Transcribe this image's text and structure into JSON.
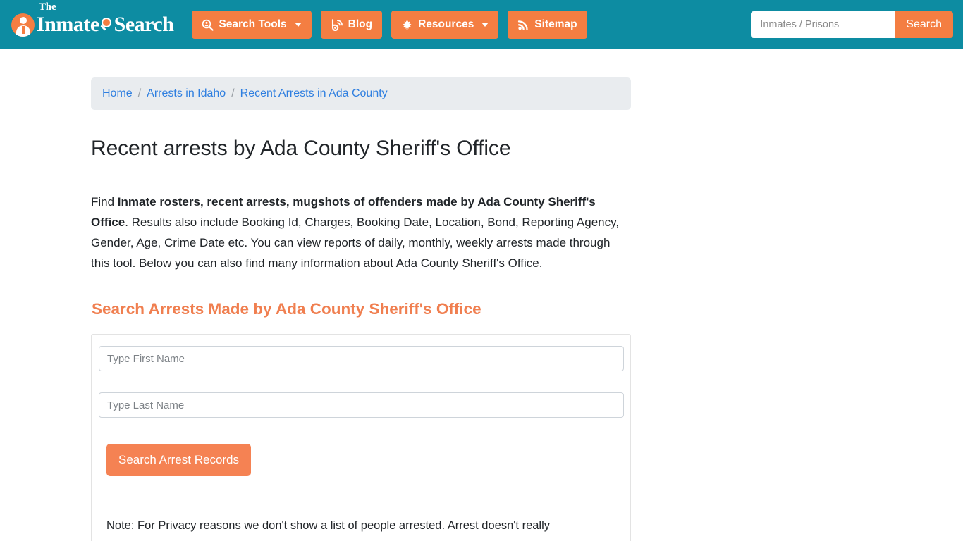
{
  "header": {
    "brand": {
      "the": "The",
      "word_one": "Inmate",
      "word_two": "Search",
      "badge_icon": "person-in-circle-icon",
      "glass_icon": "magnifier-icon"
    },
    "nav": [
      {
        "label": "Search Tools",
        "icon": "magnifier-person-icon",
        "has_caret": true
      },
      {
        "label": "Blog",
        "icon": "blog-b-icon",
        "has_caret": false
      },
      {
        "label": "Resources",
        "icon": "leaf-icon",
        "has_caret": true
      },
      {
        "label": "Sitemap",
        "icon": "rss-feed-icon",
        "has_caret": false
      }
    ],
    "search": {
      "placeholder": "Inmates / Prisons",
      "value": "",
      "button_label": "Search"
    }
  },
  "breadcrumb": [
    {
      "label": "Home",
      "link": true
    },
    {
      "label": "Arrests in Idaho",
      "link": true
    },
    {
      "label": "Recent Arrests in Ada County",
      "link": true
    }
  ],
  "breadcrumb_separator": "/",
  "main": {
    "page_title": "Recent arrests by Ada County Sheriff's Office",
    "intro": {
      "lead": "Find ",
      "bold": "Inmate rosters, recent arrests, mugshots of offenders made by Ada County Sheriff's Office",
      "rest": ". Results also include Booking Id, Charges, Booking Date, Location, Bond, Reporting Agency, Gender, Age, Crime Date etc. You can view reports of daily, monthly, weekly arrests made through this tool. Below you can also find many information about Ada County Sheriff's Office."
    },
    "section_title": "Search Arrests Made by Ada County Sheriff's Office",
    "form": {
      "first_name": {
        "placeholder": "Type First Name",
        "value": ""
      },
      "last_name": {
        "placeholder": "Type Last Name",
        "value": ""
      },
      "submit_label": "Search Arrest Records"
    },
    "note": "Note: For Privacy reasons we don't show a list of people arrested. Arrest doesn't really"
  },
  "colors": {
    "header_teal": "#0d8ca2",
    "accent_orange": "#f47e42",
    "section_heading": "#f07f50",
    "link_blue": "#2f7fe0",
    "breadcrumb_bg": "#e9ecef",
    "body_text": "#212529"
  }
}
